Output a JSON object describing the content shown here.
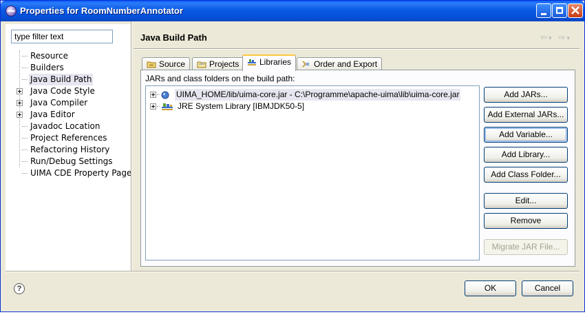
{
  "window": {
    "title": "Properties for RoomNumberAnnotator"
  },
  "left_pane": {
    "filter": {
      "placeholder": "type filter text",
      "value": "type filter text"
    },
    "tree": [
      {
        "label": "Resource",
        "expandable": false,
        "selected": false
      },
      {
        "label": "Builders",
        "expandable": false,
        "selected": false
      },
      {
        "label": "Java Build Path",
        "expandable": false,
        "selected": true
      },
      {
        "label": "Java Code Style",
        "expandable": true,
        "selected": false
      },
      {
        "label": "Java Compiler",
        "expandable": true,
        "selected": false
      },
      {
        "label": "Java Editor",
        "expandable": true,
        "selected": false
      },
      {
        "label": "Javadoc Location",
        "expandable": false,
        "selected": false
      },
      {
        "label": "Project References",
        "expandable": false,
        "selected": false
      },
      {
        "label": "Refactoring History",
        "expandable": false,
        "selected": false
      },
      {
        "label": "Run/Debug Settings",
        "expandable": false,
        "selected": false
      },
      {
        "label": "UIMA CDE Property Page",
        "expandable": false,
        "selected": false
      }
    ]
  },
  "right_pane": {
    "title": "Java Build Path",
    "nav": {
      "back": "⇦",
      "back_menu": "▾",
      "forward": "⇨",
      "forward_menu": "▾"
    },
    "tabs": [
      {
        "label": "Source",
        "icon": "source-folder-icon",
        "active": false
      },
      {
        "label": "Projects",
        "icon": "projects-icon",
        "active": false
      },
      {
        "label": "Libraries",
        "icon": "libraries-icon",
        "active": true
      },
      {
        "label": "Order and Export",
        "icon": "order-export-icon",
        "active": false
      }
    ],
    "libraries": {
      "heading": "JARs and class folders on the build path:",
      "entries": [
        {
          "label": "UIMA_HOME/lib/uima-core.jar - C:\\Programme\\apache-uima\\lib\\uima-core.jar",
          "icon": "jar-variable-icon",
          "selected": true
        },
        {
          "label": "JRE System Library [IBMJDK50-5]",
          "icon": "library-icon",
          "selected": false
        }
      ],
      "buttons": {
        "add_jars": "Add JARs...",
        "add_external_jars": "Add External JARs...",
        "add_variable": "Add Variable...",
        "add_library": "Add Library...",
        "add_class_folder": "Add Class Folder...",
        "edit": "Edit...",
        "remove": "Remove",
        "migrate_jar": "Migrate JAR File..."
      }
    }
  },
  "footer": {
    "help": "?",
    "ok": "OK",
    "cancel": "Cancel"
  },
  "colors": {
    "titlebar": "#0a5ae5",
    "dialog_bg": "#ece9d8",
    "active_tab_accent": "#ffc83c",
    "selection": "#e6e6f0"
  }
}
